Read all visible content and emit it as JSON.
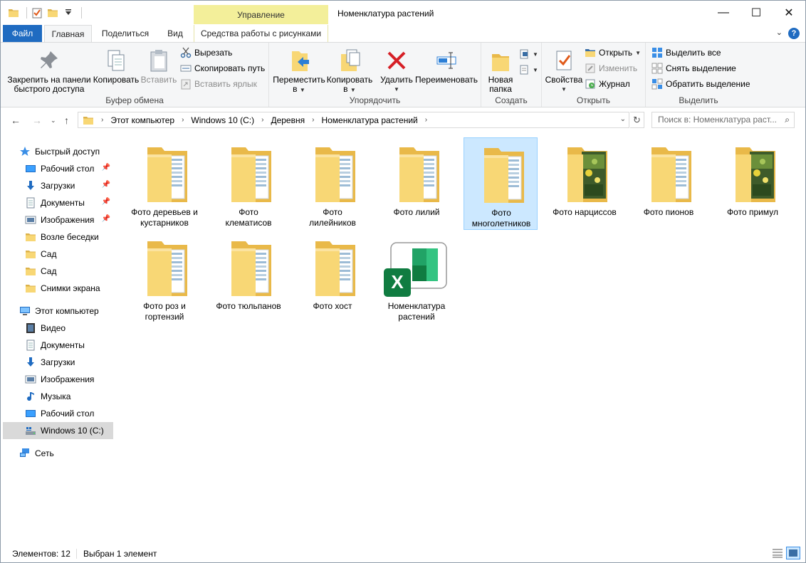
{
  "window": {
    "title": "Номенклатура растений",
    "minimize": "—",
    "maximize": "☐",
    "close": "✕",
    "context_group": "Управление"
  },
  "tabs": {
    "file": "Файл",
    "home": "Главная",
    "share": "Поделиться",
    "view": "Вид",
    "picture_tools": "Средства работы с рисунками"
  },
  "ribbon": {
    "clipboard": {
      "label": "Буфер обмена",
      "pin_line1": "Закрепить на панели",
      "pin_line2": "быстрого доступа",
      "copy": "Копировать",
      "paste": "Вставить",
      "cut": "Вырезать",
      "copy_path": "Скопировать путь",
      "paste_shortcut": "Вставить ярлык"
    },
    "organize": {
      "label": "Упорядочить",
      "move_line1": "Переместить",
      "move_line2": "в",
      "copy_line1": "Копировать",
      "copy_line2": "в",
      "delete": "Удалить",
      "rename": "Переименовать"
    },
    "new": {
      "label": "Создать",
      "new_folder_line1": "Новая",
      "new_folder_line2": "папка"
    },
    "open": {
      "label": "Открыть",
      "properties": "Свойства",
      "open": "Открыть",
      "edit": "Изменить",
      "history": "Журнал"
    },
    "select": {
      "label": "Выделить",
      "select_all": "Выделить все",
      "select_none": "Снять выделение",
      "invert": "Обратить выделение"
    }
  },
  "address": {
    "crumbs": [
      "Этот компьютер",
      "Windows 10 (C:)",
      "Деревня",
      "Номенклатура растений"
    ],
    "search_placeholder": "Поиск в: Номенклатура раст..."
  },
  "sidebar": {
    "quick_access": "Быстрый доступ",
    "quick_items": [
      "Рабочий стол",
      "Загрузки",
      "Документы",
      "Изображения",
      "Возле беседки",
      "Сад",
      "Сад",
      "Снимки экрана"
    ],
    "this_pc": "Этот компьютер",
    "pc_items": [
      "Видео",
      "Документы",
      "Загрузки",
      "Изображения",
      "Музыка",
      "Рабочий стол",
      "Windows 10 (C:)"
    ],
    "network": "Сеть"
  },
  "files": [
    {
      "line1": "Фото деревьев и",
      "line2": "кустарников",
      "kind": "folder"
    },
    {
      "line1": "Фото",
      "line2": "клематисов",
      "kind": "folder"
    },
    {
      "line1": "Фото",
      "line2": "лилейников",
      "kind": "folder"
    },
    {
      "line1": "Фото лилий",
      "line2": "",
      "kind": "folder"
    },
    {
      "line1": "Фото",
      "line2": "многолетников",
      "kind": "folder",
      "selected": true
    },
    {
      "line1": "Фото нарциссов",
      "line2": "",
      "kind": "folder-photo"
    },
    {
      "line1": "Фото пионов",
      "line2": "",
      "kind": "folder"
    },
    {
      "line1": "Фото примул",
      "line2": "",
      "kind": "folder-photo"
    },
    {
      "line1": "Фото роз и",
      "line2": "гортензий",
      "kind": "folder"
    },
    {
      "line1": "Фото тюльпанов",
      "line2": "",
      "kind": "folder"
    },
    {
      "line1": "Фото хост",
      "line2": "",
      "kind": "folder"
    },
    {
      "line1": "Номенклатура",
      "line2": "растений",
      "kind": "excel"
    }
  ],
  "status": {
    "count": "Элементов: 12",
    "selection": "Выбран 1 элемент"
  },
  "colors": {
    "file_tab": "#1f6bc1",
    "context_tab": "#f3ef9a",
    "selection": "#cce8ff",
    "folder": "#f8d775",
    "excel": "#107c41"
  }
}
